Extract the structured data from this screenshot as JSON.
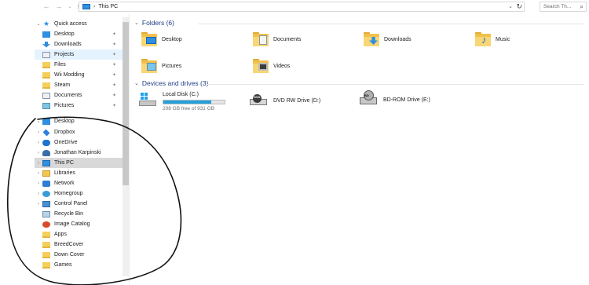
{
  "address_bar": {
    "path": "This PC",
    "search_placeholder": "Search Th..."
  },
  "nav_pane": {
    "quick_access_label": "Quick access",
    "items": [
      {
        "label": "Desktop",
        "icon": "desktop-icon",
        "pinned": true
      },
      {
        "label": "Downloads",
        "icon": "downloads-icon",
        "pinned": true
      },
      {
        "label": "Projects",
        "icon": "documents-icon",
        "pinned": true
      },
      {
        "label": "Files",
        "icon": "folder-icon",
        "pinned": true
      },
      {
        "label": "Wii Modding",
        "icon": "folder-icon",
        "pinned": true
      },
      {
        "label": "Steam",
        "icon": "folder-icon",
        "pinned": true
      },
      {
        "label": "Documents",
        "icon": "documents-icon",
        "pinned": true
      },
      {
        "label": "Pictures",
        "icon": "pictures-icon",
        "pinned": true
      }
    ],
    "desktop_label": "Desktop",
    "desktop_children": [
      {
        "label": "Dropbox",
        "icon": "dropbox-icon"
      },
      {
        "label": "OneDrive",
        "icon": "onedrive-icon"
      },
      {
        "label": "Jonathan Karpinski",
        "icon": "user-icon"
      },
      {
        "label": "This PC",
        "icon": "this-pc-icon"
      },
      {
        "label": "Libraries",
        "icon": "libraries-icon"
      },
      {
        "label": "Network",
        "icon": "network-icon"
      },
      {
        "label": "Homegroup",
        "icon": "homegroup-icon"
      },
      {
        "label": "Control Panel",
        "icon": "control-panel-icon"
      },
      {
        "label": "Recycle Bin",
        "icon": "recycle-bin-icon"
      },
      {
        "label": "Image Catalog",
        "icon": "image-catalog-icon"
      },
      {
        "label": "Apps",
        "icon": "folder-icon"
      },
      {
        "label": "BreedCover",
        "icon": "folder-icon"
      },
      {
        "label": "Down Cover",
        "icon": "folder-icon"
      },
      {
        "label": "Games",
        "icon": "folder-icon"
      }
    ]
  },
  "content": {
    "folders_header": "Folders (6)",
    "folders": [
      {
        "label": "Desktop",
        "icon": "desktop-folder-icon"
      },
      {
        "label": "Documents",
        "icon": "documents-folder-icon"
      },
      {
        "label": "Downloads",
        "icon": "downloads-folder-icon"
      },
      {
        "label": "Music",
        "icon": "music-folder-icon"
      },
      {
        "label": "Pictures",
        "icon": "pictures-folder-icon"
      },
      {
        "label": "Videos",
        "icon": "videos-folder-icon"
      }
    ],
    "devices_header": "Devices and drives (3)",
    "drives": [
      {
        "label": "Local Disk (C:)",
        "free_text": "208 GB free of 931 GB",
        "used_fraction": 0.78,
        "icon": "windows-drive-icon"
      },
      {
        "label": "DVD RW Drive (D:)",
        "icon": "dvd-drive-icon"
      },
      {
        "label": "BD-ROM Drive (E:)",
        "icon": "bd-rom-drive-icon"
      }
    ]
  },
  "colors": {
    "accent": "#26a0da",
    "header_text": "#1e3f86",
    "selection": "#d9d9d9"
  }
}
